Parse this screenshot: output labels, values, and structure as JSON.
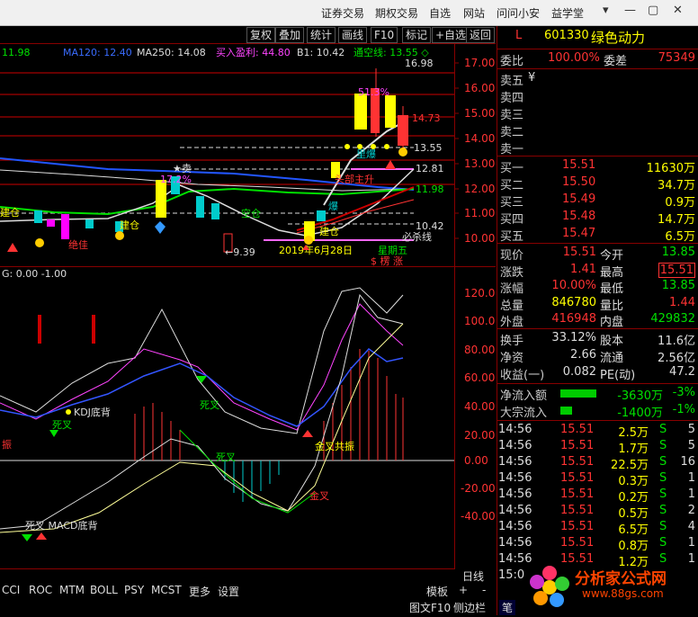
{
  "menu": [
    "证券交易",
    "期权交易",
    "自选",
    "网站",
    "问问小安",
    "益学堂"
  ],
  "window_controls": [
    "▾",
    "—",
    "▢",
    "✕"
  ],
  "toolbar": [
    "复权",
    "叠加",
    "统计",
    "画线",
    "F10",
    "标记",
    "+自选",
    "返回"
  ],
  "stock": {
    "marker": "L",
    "code": "601330",
    "name": "绿色动力"
  },
  "indicator_header": {
    "ma_partial": "11.98",
    "ma120": "MA120: 12.40",
    "ma250": "MA250: 14.08",
    "buy_profit": "买入盈利: 44.80",
    "b1": "B1: 10.42",
    "tongkong": "通空线: 13.55 ◇"
  },
  "price_axis": [
    "17.00",
    "16.00",
    "15.00",
    "14.00",
    "13.00",
    "12.00",
    "11.00",
    "10.00"
  ],
  "osc_axis": [
    "120.0",
    "100.0",
    "80.00",
    "60.00",
    "40.00",
    "20.00",
    "0.00",
    "-20.00",
    "-40.00"
  ],
  "price_tags": [
    {
      "text": "16.98",
      "color": "#ddd"
    },
    {
      "text": "14.73",
      "color": "#ff3333"
    },
    {
      "text": "13.55",
      "color": "#ddd"
    },
    {
      "text": "12.81",
      "color": "#ddd"
    },
    {
      "text": "11.98",
      "color": "#00e000"
    },
    {
      "text": "10.42",
      "color": "#ddd"
    }
  ],
  "chart_annotations": {
    "jian_cang_1": "建仓",
    "jian_cang_2": "建仓",
    "jian_cang_3": "建仓",
    "jue_jia": "绝佳",
    "mai": "★卖",
    "pct_1": "17.2%",
    "pct_2": "51.3%",
    "kong_cang": "空仓",
    "li_bao": "里爆",
    "bao": "爆",
    "zhu_sheng": "头部主升",
    "bi_sha": "必杀线",
    "low_price": "←9.39",
    "date": "2019年6月28日",
    "weekday": "星期五",
    "bao_zhang": "$ 楞 涨"
  },
  "osc_header": "G: 0.00   -1.00",
  "osc_labels": {
    "kdj": "KDJ底背",
    "sicha_1": "死叉",
    "sicha_2": "死叉",
    "sicha_3": "死叉",
    "zhen": "振",
    "jinchagongzhen": "金叉共振",
    "jincha": "金叉",
    "macd": "死叉 MACD底背"
  },
  "x_marker": "6",
  "period": "日线",
  "bottom_tabs": [
    "CCI",
    "ROC",
    "MTM",
    "BOLL",
    "PSY",
    "MCST",
    "更多",
    "设置"
  ],
  "bottom_controls": {
    "template": "模板",
    "plus": "+",
    "minus": "-"
  },
  "status": [
    "图文F10",
    "侧边栏",
    "笔"
  ],
  "order_book": {
    "weibi_label": "委比",
    "weibi": "100.00%",
    "weicha_label": "委差",
    "weicha": "75349",
    "sells": [
      {
        "label": "卖五",
        "price": "¥",
        "vol": ""
      },
      {
        "label": "卖四",
        "price": "",
        "vol": ""
      },
      {
        "label": "卖三",
        "price": "",
        "vol": ""
      },
      {
        "label": "卖二",
        "price": "",
        "vol": ""
      },
      {
        "label": "卖一",
        "price": "",
        "vol": ""
      }
    ],
    "buys": [
      {
        "label": "买一",
        "price": "15.51",
        "vol": "11630万"
      },
      {
        "label": "买二",
        "price": "15.50",
        "vol": "34.7万"
      },
      {
        "label": "买三",
        "price": "15.49",
        "vol": "0.9万"
      },
      {
        "label": "买四",
        "price": "15.48",
        "vol": "14.7万"
      },
      {
        "label": "买五",
        "price": "15.47",
        "vol": "6.5万"
      }
    ]
  },
  "quote": [
    {
      "l1": "现价",
      "v1": "15.51",
      "c1": "#ff3333",
      "l2": "今开",
      "v2": "13.85",
      "c2": "#00e000"
    },
    {
      "l1": "涨跌",
      "v1": "1.41",
      "c1": "#ff3333",
      "l2": "最高",
      "v2": "15.51",
      "c2": "#ff3333"
    },
    {
      "l1": "涨幅",
      "v1": "10.00%",
      "c1": "#ff3333",
      "l2": "最低",
      "v2": "13.85",
      "c2": "#00e000"
    },
    {
      "l1": "总量",
      "v1": "846780",
      "c1": "#ffff00",
      "l2": "量比",
      "v2": "1.44",
      "c2": "#ff3333"
    },
    {
      "l1": "外盘",
      "v1": "416948",
      "c1": "#ff3333",
      "l2": "内盘",
      "v2": "429832",
      "c2": "#00e000"
    }
  ],
  "stats": [
    {
      "l1": "换手",
      "v1": "33.12%",
      "l2": "股本",
      "v2": "11.6亿"
    },
    {
      "l1": "净资",
      "v1": "2.66",
      "l2": "流通",
      "v2": "2.56亿"
    },
    {
      "l1": "收益(一)",
      "v1": "0.082",
      "l2": "PE(动)",
      "v2": "47.2"
    }
  ],
  "flows": [
    {
      "label": "净流入额",
      "value": "-3630万",
      "pct": "-3%",
      "bar": 0.8
    },
    {
      "label": "大宗流入",
      "value": "-1400万",
      "pct": "-1%",
      "bar": 0.25
    }
  ],
  "ticks": [
    {
      "t": "14:56",
      "p": "15.51",
      "v": "2.5万",
      "s": "S",
      "n": "5"
    },
    {
      "t": "14:56",
      "p": "15.51",
      "v": "1.7万",
      "s": "S",
      "n": "5"
    },
    {
      "t": "14:56",
      "p": "15.51",
      "v": "22.5万",
      "s": "S",
      "n": "16"
    },
    {
      "t": "14:56",
      "p": "15.51",
      "v": "0.3万",
      "s": "S",
      "n": "1"
    },
    {
      "t": "14:56",
      "p": "15.51",
      "v": "0.2万",
      "s": "S",
      "n": "1"
    },
    {
      "t": "14:56",
      "p": "15.51",
      "v": "0.5万",
      "s": "S",
      "n": "2"
    },
    {
      "t": "14:56",
      "p": "15.51",
      "v": "6.5万",
      "s": "S",
      "n": "4"
    },
    {
      "t": "14:56",
      "p": "15.51",
      "v": "0.8万",
      "s": "S",
      "n": "1"
    },
    {
      "t": "14:56",
      "p": "15.51",
      "v": "1.2万",
      "s": "S",
      "n": "1"
    },
    {
      "t": "15:0",
      "p": "",
      "v": "",
      "s": "",
      "n": ""
    }
  ],
  "watermark": {
    "name": "分析家公式网",
    "url": "www.88gs.com"
  }
}
